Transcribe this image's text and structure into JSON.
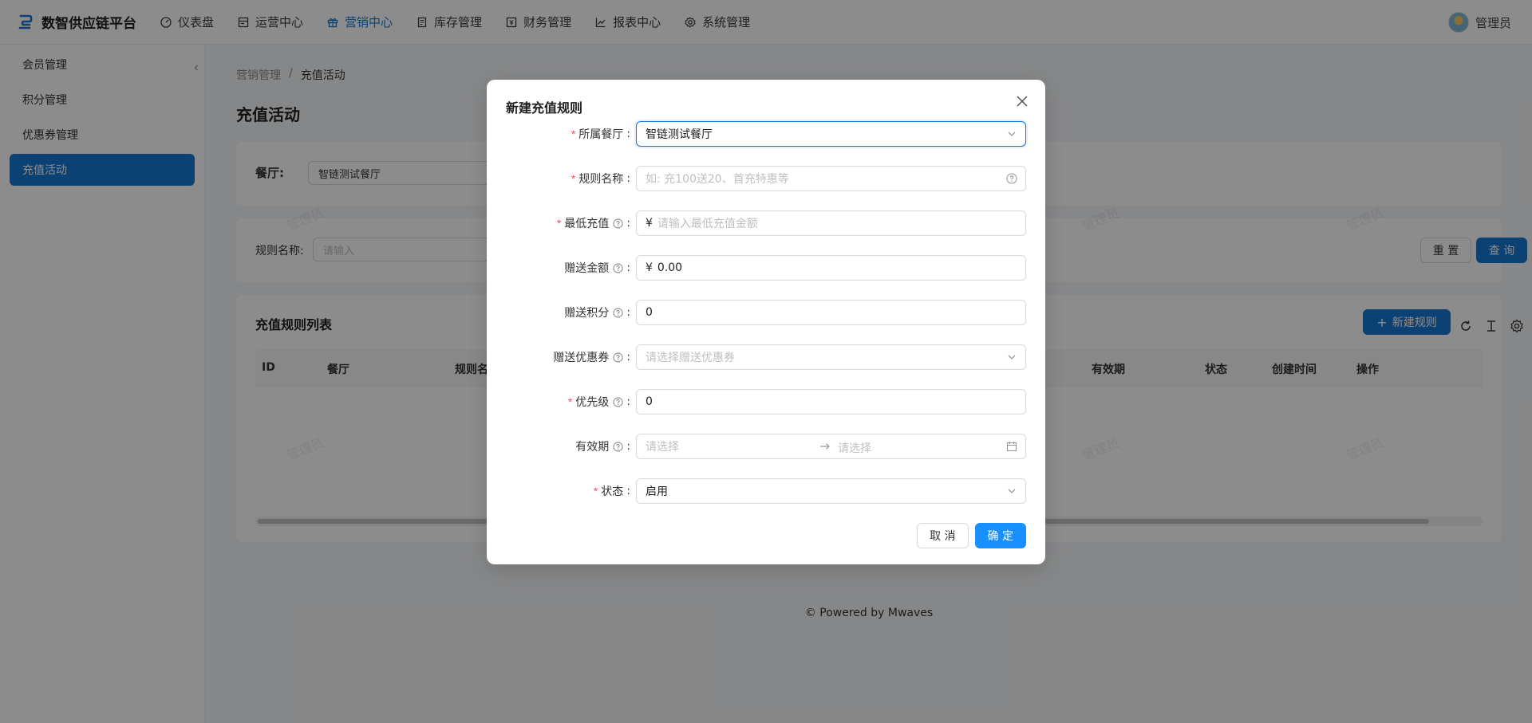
{
  "app": {
    "title": "数智供应链平台",
    "brand_color": "#1677d4"
  },
  "nav": {
    "items": [
      {
        "label": "仪表盘",
        "icon": "dashboard-icon"
      },
      {
        "label": "运营中心",
        "icon": "store-icon"
      },
      {
        "label": "营销中心",
        "icon": "gift-icon",
        "active": true
      },
      {
        "label": "库存管理",
        "icon": "inventory-icon"
      },
      {
        "label": "财务管理",
        "icon": "finance-icon"
      },
      {
        "label": "报表中心",
        "icon": "chart-icon"
      },
      {
        "label": "系统管理",
        "icon": "settings-icon"
      }
    ]
  },
  "user": {
    "name": "管理员"
  },
  "sidebar": {
    "items": [
      {
        "label": "会员管理"
      },
      {
        "label": "积分管理"
      },
      {
        "label": "优惠券管理"
      },
      {
        "label": "充值活动",
        "active": true
      }
    ]
  },
  "breadcrumb": {
    "parent": "营销管理",
    "separator": "/",
    "current": "充值活动"
  },
  "page": {
    "title": "充值活动"
  },
  "filter": {
    "restaurant_label": "餐厅:",
    "restaurant_value": "智链测试餐厅",
    "rule_name_label": "规则名称:",
    "rule_name_placeholder": "请输入",
    "reset_label": "重 置",
    "query_label": "查 询"
  },
  "table": {
    "title": "充值规则列表",
    "new_button": "新建规则",
    "columns": [
      "ID",
      "餐厅",
      "规则名",
      "有效期",
      "状态",
      "创建时间",
      "操作"
    ]
  },
  "footer": {
    "text": "Powered by Mwaves"
  },
  "watermark": {
    "text": "管理员"
  },
  "modal": {
    "title": "新建充值规则",
    "fields": {
      "restaurant": {
        "label": "所属餐厅",
        "value": "智链测试餐厅",
        "required": true
      },
      "rule_name": {
        "label": "规则名称",
        "placeholder": "如: 充100送20、首充特惠等",
        "required": true
      },
      "min_recharge": {
        "label": "最低充值",
        "prefix": "¥",
        "placeholder": "请输入最低充值金额",
        "required": true
      },
      "gift_amount": {
        "label": "赠送金额",
        "prefix": "¥",
        "value": "0.00"
      },
      "gift_points": {
        "label": "赠送积分",
        "value": "0"
      },
      "gift_coupon": {
        "label": "赠送优惠券",
        "placeholder": "请选择赠送优惠券"
      },
      "priority": {
        "label": "优先级",
        "value": "0",
        "required": true
      },
      "validity": {
        "label": "有效期",
        "start_placeholder": "请选择",
        "end_placeholder": "请选择"
      },
      "status": {
        "label": "状态",
        "value": "启用",
        "required": true
      }
    },
    "cancel_label": "取 消",
    "ok_label": "确 定"
  }
}
